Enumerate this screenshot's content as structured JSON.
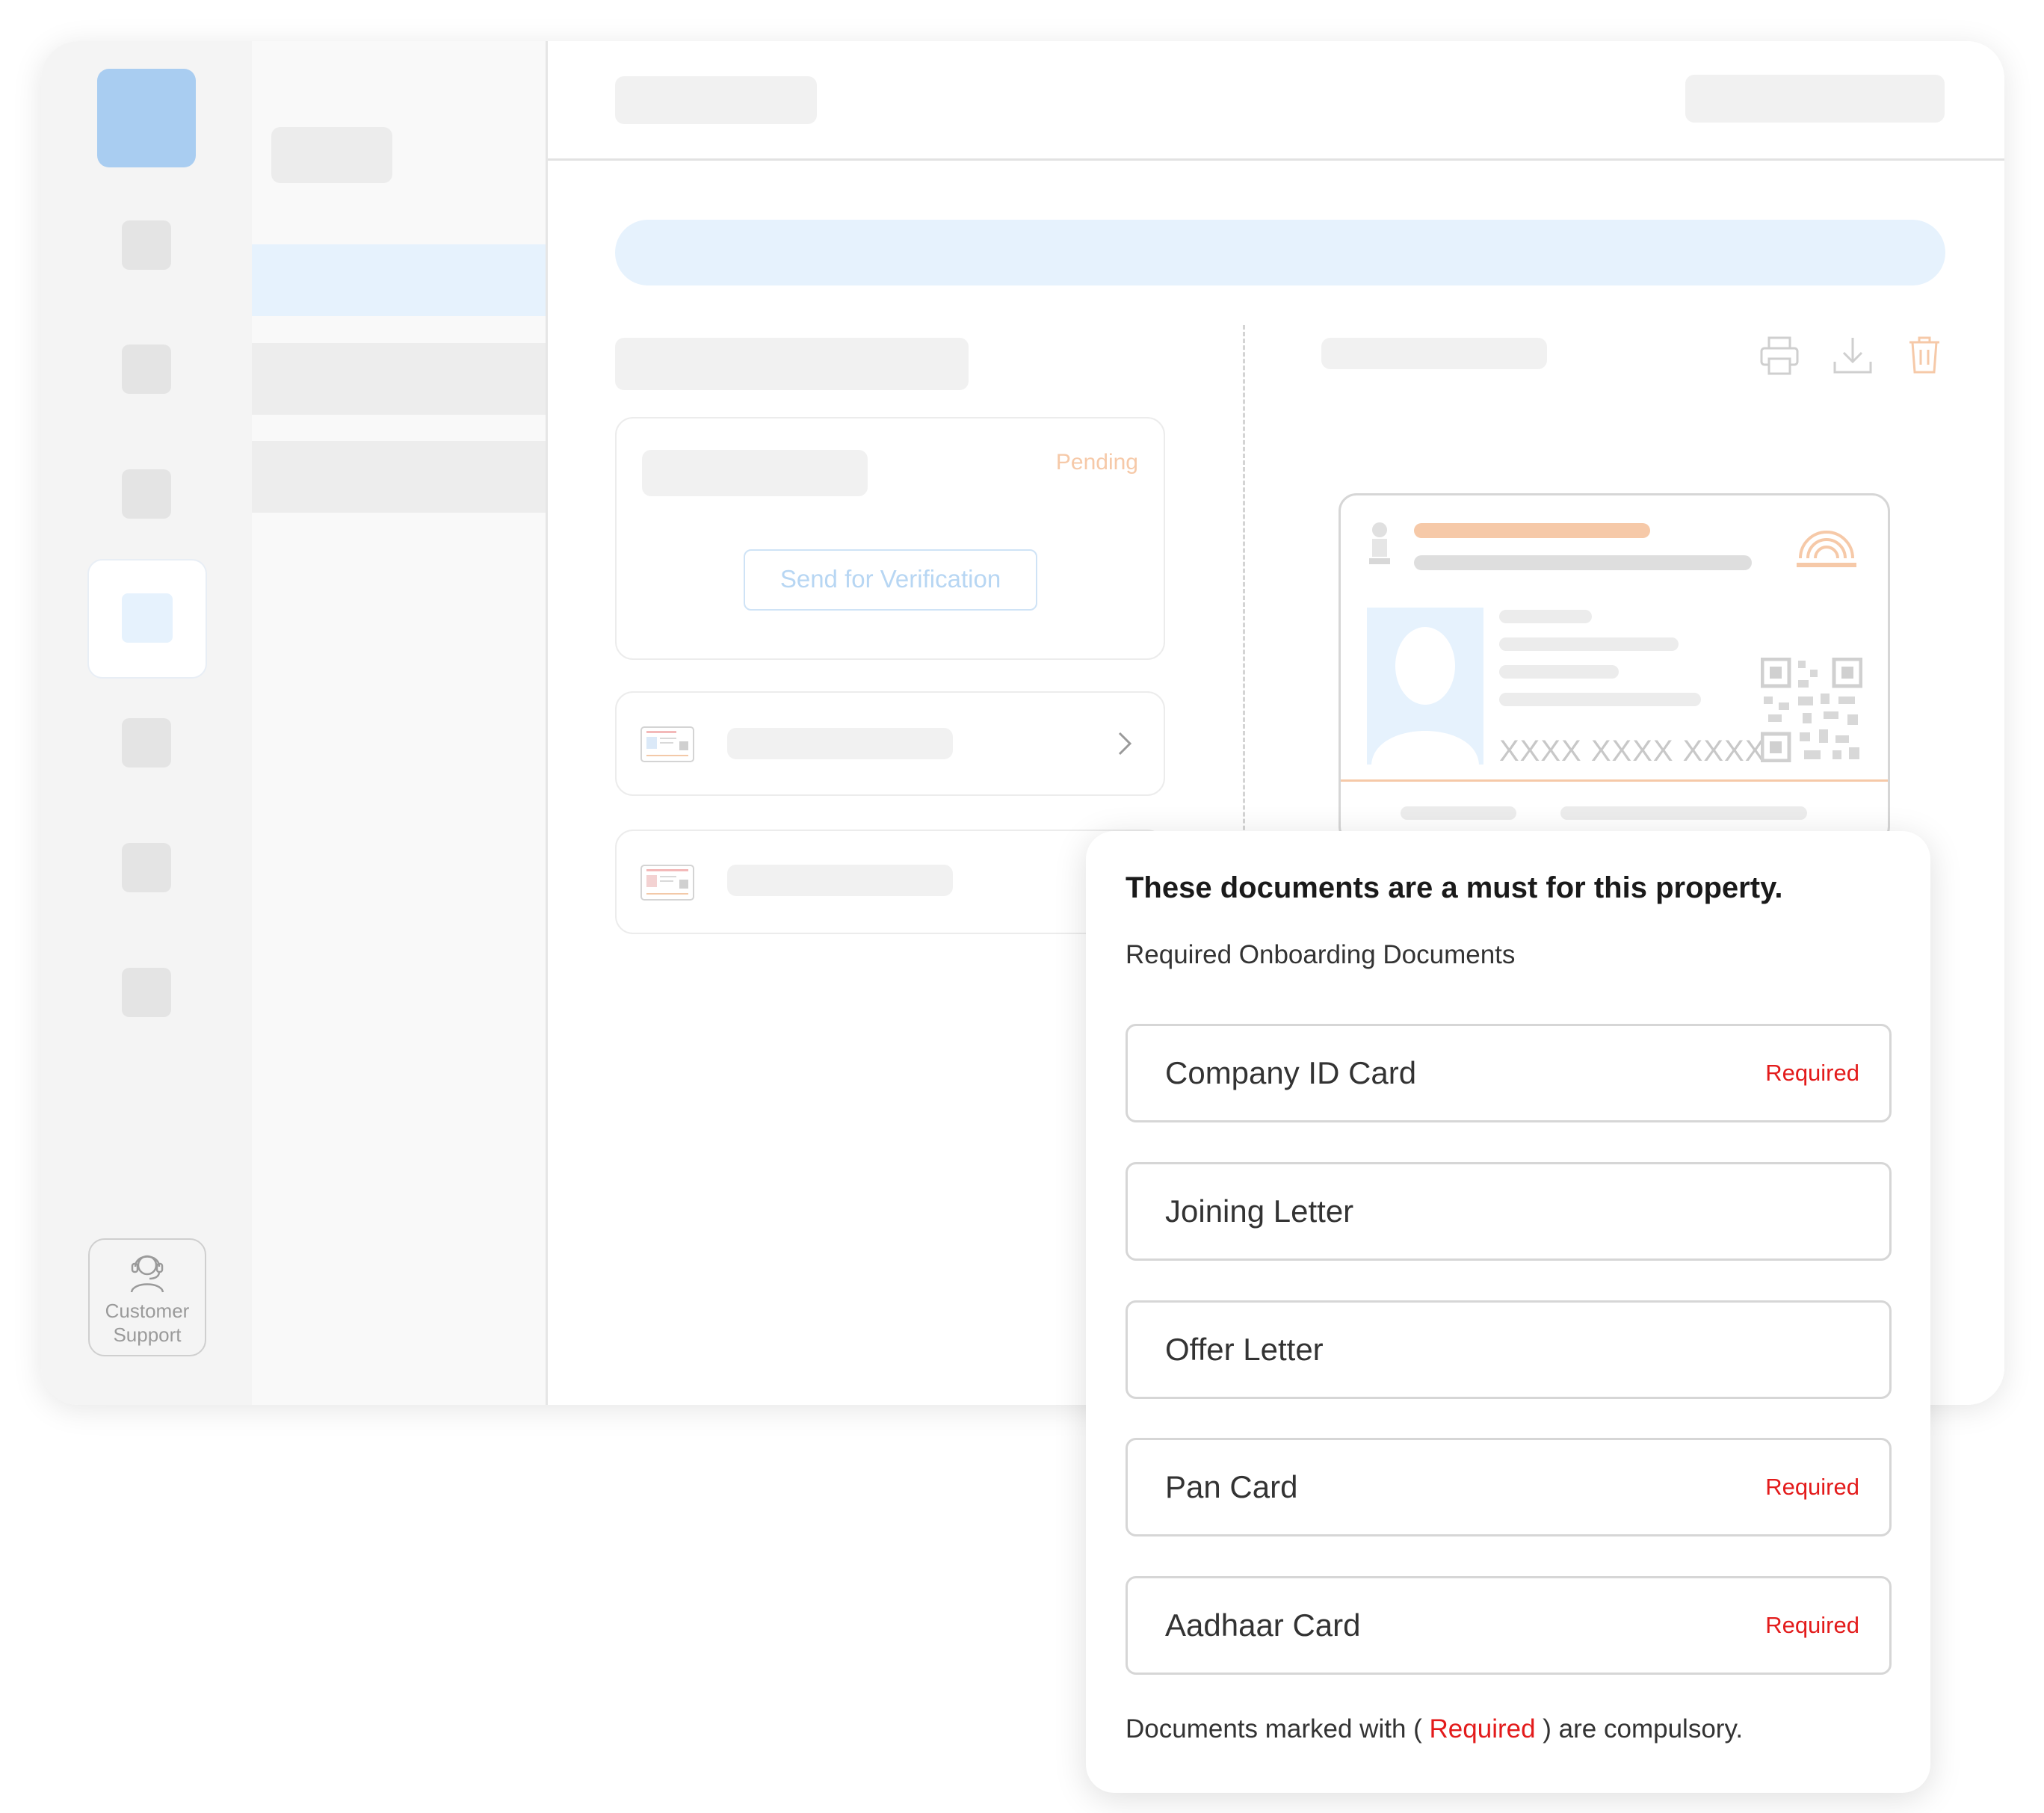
{
  "sidebar": {
    "support_line1": "Customer",
    "support_line2": "Support"
  },
  "background": {
    "status": "Pending",
    "verify_button": "Send for Verification",
    "id_mask": "XXXX XXXX XXXX"
  },
  "modal": {
    "title": "These documents are a must for this property.",
    "subtitle": "Required Onboarding Documents",
    "documents": [
      {
        "label": "Company ID Card",
        "badge": "Required"
      },
      {
        "label": "Joining Letter",
        "badge": ""
      },
      {
        "label": "Offer Letter",
        "badge": ""
      },
      {
        "label": "Pan Card",
        "badge": "Required"
      },
      {
        "label": "Aadhaar Card",
        "badge": "Required"
      }
    ],
    "footer_before": "Documents marked with ( ",
    "footer_required": "Required",
    "footer_after": " ) are compulsory."
  },
  "colors": {
    "accent_blue": "#a9cdf1",
    "light_blue": "#e6f2fd",
    "required_red": "#e31b1b",
    "pending_orange": "#f6c9a8"
  }
}
